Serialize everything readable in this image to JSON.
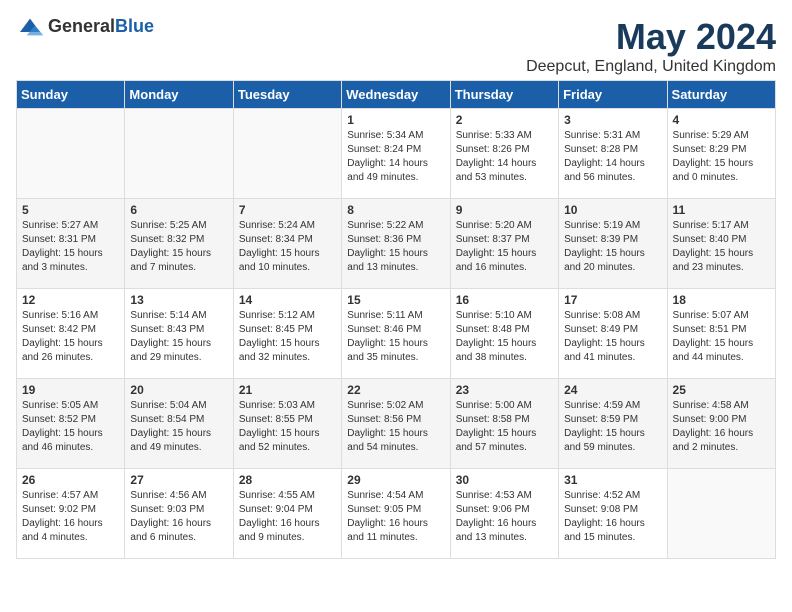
{
  "logo": {
    "general": "General",
    "blue": "Blue"
  },
  "title": "May 2024",
  "location": "Deepcut, England, United Kingdom",
  "weekdays": [
    "Sunday",
    "Monday",
    "Tuesday",
    "Wednesday",
    "Thursday",
    "Friday",
    "Saturday"
  ],
  "rows": [
    [
      {
        "day": "",
        "info": ""
      },
      {
        "day": "",
        "info": ""
      },
      {
        "day": "",
        "info": ""
      },
      {
        "day": "1",
        "info": "Sunrise: 5:34 AM\nSunset: 8:24 PM\nDaylight: 14 hours\nand 49 minutes."
      },
      {
        "day": "2",
        "info": "Sunrise: 5:33 AM\nSunset: 8:26 PM\nDaylight: 14 hours\nand 53 minutes."
      },
      {
        "day": "3",
        "info": "Sunrise: 5:31 AM\nSunset: 8:28 PM\nDaylight: 14 hours\nand 56 minutes."
      },
      {
        "day": "4",
        "info": "Sunrise: 5:29 AM\nSunset: 8:29 PM\nDaylight: 15 hours\nand 0 minutes."
      }
    ],
    [
      {
        "day": "5",
        "info": "Sunrise: 5:27 AM\nSunset: 8:31 PM\nDaylight: 15 hours\nand 3 minutes."
      },
      {
        "day": "6",
        "info": "Sunrise: 5:25 AM\nSunset: 8:32 PM\nDaylight: 15 hours\nand 7 minutes."
      },
      {
        "day": "7",
        "info": "Sunrise: 5:24 AM\nSunset: 8:34 PM\nDaylight: 15 hours\nand 10 minutes."
      },
      {
        "day": "8",
        "info": "Sunrise: 5:22 AM\nSunset: 8:36 PM\nDaylight: 15 hours\nand 13 minutes."
      },
      {
        "day": "9",
        "info": "Sunrise: 5:20 AM\nSunset: 8:37 PM\nDaylight: 15 hours\nand 16 minutes."
      },
      {
        "day": "10",
        "info": "Sunrise: 5:19 AM\nSunset: 8:39 PM\nDaylight: 15 hours\nand 20 minutes."
      },
      {
        "day": "11",
        "info": "Sunrise: 5:17 AM\nSunset: 8:40 PM\nDaylight: 15 hours\nand 23 minutes."
      }
    ],
    [
      {
        "day": "12",
        "info": "Sunrise: 5:16 AM\nSunset: 8:42 PM\nDaylight: 15 hours\nand 26 minutes."
      },
      {
        "day": "13",
        "info": "Sunrise: 5:14 AM\nSunset: 8:43 PM\nDaylight: 15 hours\nand 29 minutes."
      },
      {
        "day": "14",
        "info": "Sunrise: 5:12 AM\nSunset: 8:45 PM\nDaylight: 15 hours\nand 32 minutes."
      },
      {
        "day": "15",
        "info": "Sunrise: 5:11 AM\nSunset: 8:46 PM\nDaylight: 15 hours\nand 35 minutes."
      },
      {
        "day": "16",
        "info": "Sunrise: 5:10 AM\nSunset: 8:48 PM\nDaylight: 15 hours\nand 38 minutes."
      },
      {
        "day": "17",
        "info": "Sunrise: 5:08 AM\nSunset: 8:49 PM\nDaylight: 15 hours\nand 41 minutes."
      },
      {
        "day": "18",
        "info": "Sunrise: 5:07 AM\nSunset: 8:51 PM\nDaylight: 15 hours\nand 44 minutes."
      }
    ],
    [
      {
        "day": "19",
        "info": "Sunrise: 5:05 AM\nSunset: 8:52 PM\nDaylight: 15 hours\nand 46 minutes."
      },
      {
        "day": "20",
        "info": "Sunrise: 5:04 AM\nSunset: 8:54 PM\nDaylight: 15 hours\nand 49 minutes."
      },
      {
        "day": "21",
        "info": "Sunrise: 5:03 AM\nSunset: 8:55 PM\nDaylight: 15 hours\nand 52 minutes."
      },
      {
        "day": "22",
        "info": "Sunrise: 5:02 AM\nSunset: 8:56 PM\nDaylight: 15 hours\nand 54 minutes."
      },
      {
        "day": "23",
        "info": "Sunrise: 5:00 AM\nSunset: 8:58 PM\nDaylight: 15 hours\nand 57 minutes."
      },
      {
        "day": "24",
        "info": "Sunrise: 4:59 AM\nSunset: 8:59 PM\nDaylight: 15 hours\nand 59 minutes."
      },
      {
        "day": "25",
        "info": "Sunrise: 4:58 AM\nSunset: 9:00 PM\nDaylight: 16 hours\nand 2 minutes."
      }
    ],
    [
      {
        "day": "26",
        "info": "Sunrise: 4:57 AM\nSunset: 9:02 PM\nDaylight: 16 hours\nand 4 minutes."
      },
      {
        "day": "27",
        "info": "Sunrise: 4:56 AM\nSunset: 9:03 PM\nDaylight: 16 hours\nand 6 minutes."
      },
      {
        "day": "28",
        "info": "Sunrise: 4:55 AM\nSunset: 9:04 PM\nDaylight: 16 hours\nand 9 minutes."
      },
      {
        "day": "29",
        "info": "Sunrise: 4:54 AM\nSunset: 9:05 PM\nDaylight: 16 hours\nand 11 minutes."
      },
      {
        "day": "30",
        "info": "Sunrise: 4:53 AM\nSunset: 9:06 PM\nDaylight: 16 hours\nand 13 minutes."
      },
      {
        "day": "31",
        "info": "Sunrise: 4:52 AM\nSunset: 9:08 PM\nDaylight: 16 hours\nand 15 minutes."
      },
      {
        "day": "",
        "info": ""
      }
    ]
  ]
}
